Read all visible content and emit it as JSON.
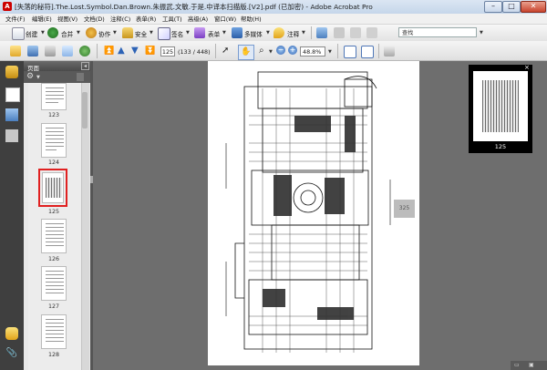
{
  "window": {
    "title": "[失落的秘符].The.Lost.Symbol.Dan.Brown.朱振武.文敏.于是.中译本扫描版.[V2].pdf (已加密) - Adobe Acrobat Pro",
    "min_label": "–",
    "max_label": "□",
    "close_label": "✕"
  },
  "menu": {
    "items": [
      "文件(F)",
      "编辑(E)",
      "视图(V)",
      "文档(D)",
      "注释(C)",
      "表单(R)",
      "工具(T)",
      "高级(A)",
      "窗口(W)",
      "帮助(H)"
    ]
  },
  "toolbar1": {
    "create": "创建",
    "combine": "合并",
    "collaborate": "协作",
    "secure": "安全",
    "sign": "签名",
    "forms": "表单",
    "multimedia": "多媒体",
    "comment": "注释",
    "search_placeholder": "查找"
  },
  "toolbar2": {
    "page_number": "125",
    "page_count": "(133 / 448)",
    "zoom": "48.8%"
  },
  "panel": {
    "title": "页面",
    "thumbnails": [
      {
        "label": "123",
        "selected": false
      },
      {
        "label": "124",
        "selected": false
      },
      {
        "label": "125",
        "selected": true
      },
      {
        "label": "126",
        "selected": false
      },
      {
        "label": "127",
        "selected": false
      },
      {
        "label": "128",
        "selected": false
      }
    ]
  },
  "document": {
    "side_tab_label": "325"
  },
  "navigator": {
    "label": "125",
    "close": "×"
  },
  "colors": {
    "selection_border": "#e02020",
    "rail": "#3f3f3f",
    "doc_bg": "#6e6e6e"
  }
}
